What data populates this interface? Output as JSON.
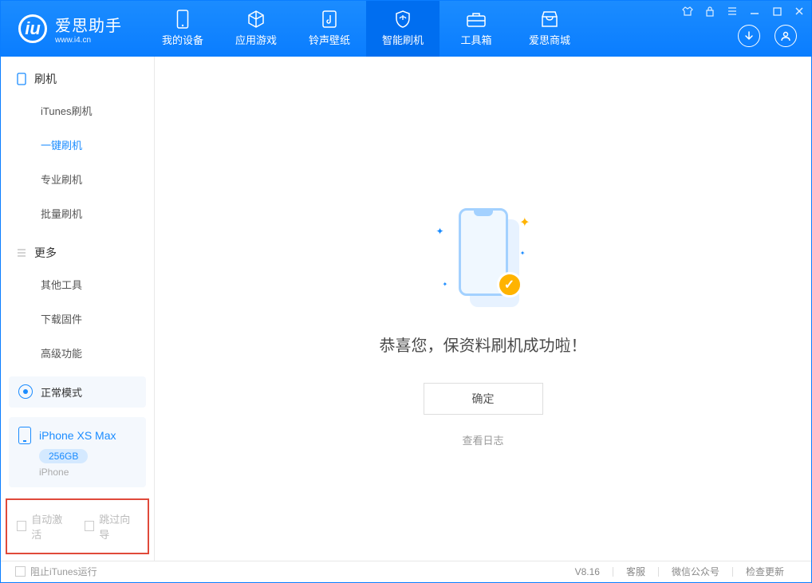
{
  "app": {
    "name_cn": "爱思助手",
    "name_en": "www.i4.cn"
  },
  "nav": {
    "tabs": [
      {
        "label": "我的设备"
      },
      {
        "label": "应用游戏"
      },
      {
        "label": "铃声壁纸"
      },
      {
        "label": "智能刷机"
      },
      {
        "label": "工具箱"
      },
      {
        "label": "爱思商城"
      }
    ]
  },
  "sidebar": {
    "section1_title": "刷机",
    "items1": [
      {
        "label": "iTunes刷机"
      },
      {
        "label": "一键刷机"
      },
      {
        "label": "专业刷机"
      },
      {
        "label": "批量刷机"
      }
    ],
    "section2_title": "更多",
    "items2": [
      {
        "label": "其他工具"
      },
      {
        "label": "下载固件"
      },
      {
        "label": "高级功能"
      }
    ],
    "mode_label": "正常模式",
    "device": {
      "name": "iPhone XS Max",
      "capacity": "256GB",
      "type": "iPhone"
    },
    "check1_label": "自动激活",
    "check2_label": "跳过向导"
  },
  "main": {
    "success_text": "恭喜您，保资料刷机成功啦！",
    "ok_button": "确定",
    "log_link": "查看日志"
  },
  "footer": {
    "block_itunes": "阻止iTunes运行",
    "version": "V8.16",
    "support": "客服",
    "wechat": "微信公众号",
    "update": "检查更新"
  }
}
